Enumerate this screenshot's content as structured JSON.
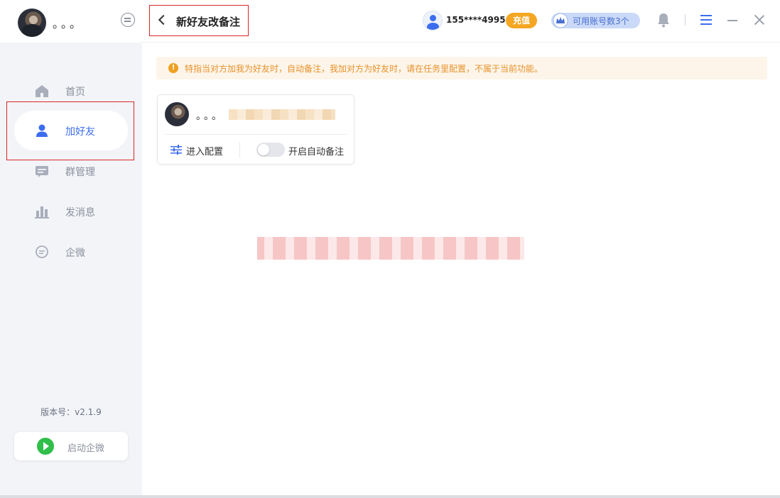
{
  "sidebar": {
    "nickname": "。。。",
    "items": [
      {
        "label": "首页",
        "icon": "home-icon",
        "active": false
      },
      {
        "label": "加好友",
        "icon": "user-icon",
        "active": true
      },
      {
        "label": "群管理",
        "icon": "group-manage-icon",
        "active": false
      },
      {
        "label": "发消息",
        "icon": "message-chart-icon",
        "active": false
      },
      {
        "label": "企微",
        "icon": "chat-bubble-icon",
        "active": false
      }
    ],
    "version": "版本号：v2.1.9",
    "start_label": "启动企微"
  },
  "header": {
    "title": "新好友改备注",
    "phone": "155****4995",
    "recharge_label": "充值",
    "accounts_label": "可用账号数3个"
  },
  "notice": {
    "text": "特指当对方加我为好友时，自动备注，我加对方为好友时，请在任务里配置，不属于当前功能。"
  },
  "card": {
    "name": "。。。",
    "config_label": "进入配置",
    "toggle_label": "开启自动备注",
    "toggle_on": false
  },
  "colors": {
    "accent": "#3c6df0",
    "warning": "#e8912b",
    "recharge": "#f5a623",
    "highlight": "#d92626"
  }
}
